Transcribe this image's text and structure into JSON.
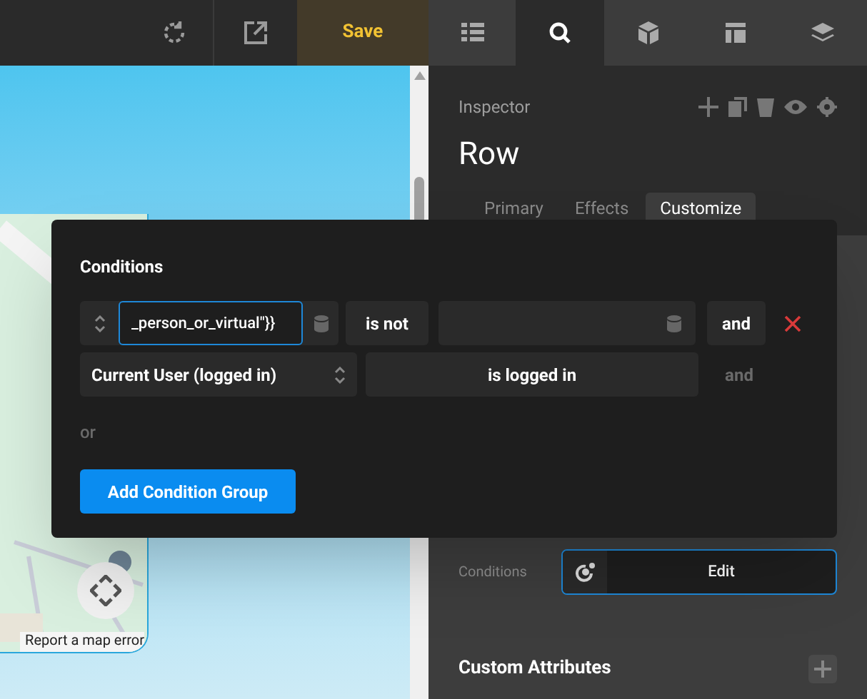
{
  "toolbar": {
    "save_label": "Save",
    "tabs": [
      {
        "kind": "list",
        "selected": false
      },
      {
        "kind": "search",
        "selected": true
      },
      {
        "kind": "cube",
        "selected": false
      },
      {
        "kind": "layout",
        "selected": false
      },
      {
        "kind": "layers",
        "selected": false
      }
    ]
  },
  "canvas": {
    "map": {
      "kind": "picture",
      "report_link": "Report a map error"
    }
  },
  "inspector": {
    "title": "Inspector",
    "heading": "Row",
    "tabs": [
      {
        "label": "Primary",
        "selected": false
      },
      {
        "label": "Effects",
        "selected": false
      },
      {
        "label": "Customize",
        "selected": true
      }
    ],
    "conditions_label": "Conditions",
    "edit_label": "Edit",
    "custom_attributes": "Custom Attributes"
  },
  "modal": {
    "title": "Conditions",
    "rows": [
      {
        "kind": "expression",
        "value": "_person_or_virtual\"}}",
        "operator": "is not",
        "join": "and",
        "join_active": true,
        "removable": true
      },
      {
        "kind": "select",
        "field": "Current User (logged in)",
        "operator": "is logged in",
        "join": "and",
        "join_active": false,
        "removable": false
      }
    ],
    "or_label": "or",
    "add_button": "Add Condition Group"
  }
}
